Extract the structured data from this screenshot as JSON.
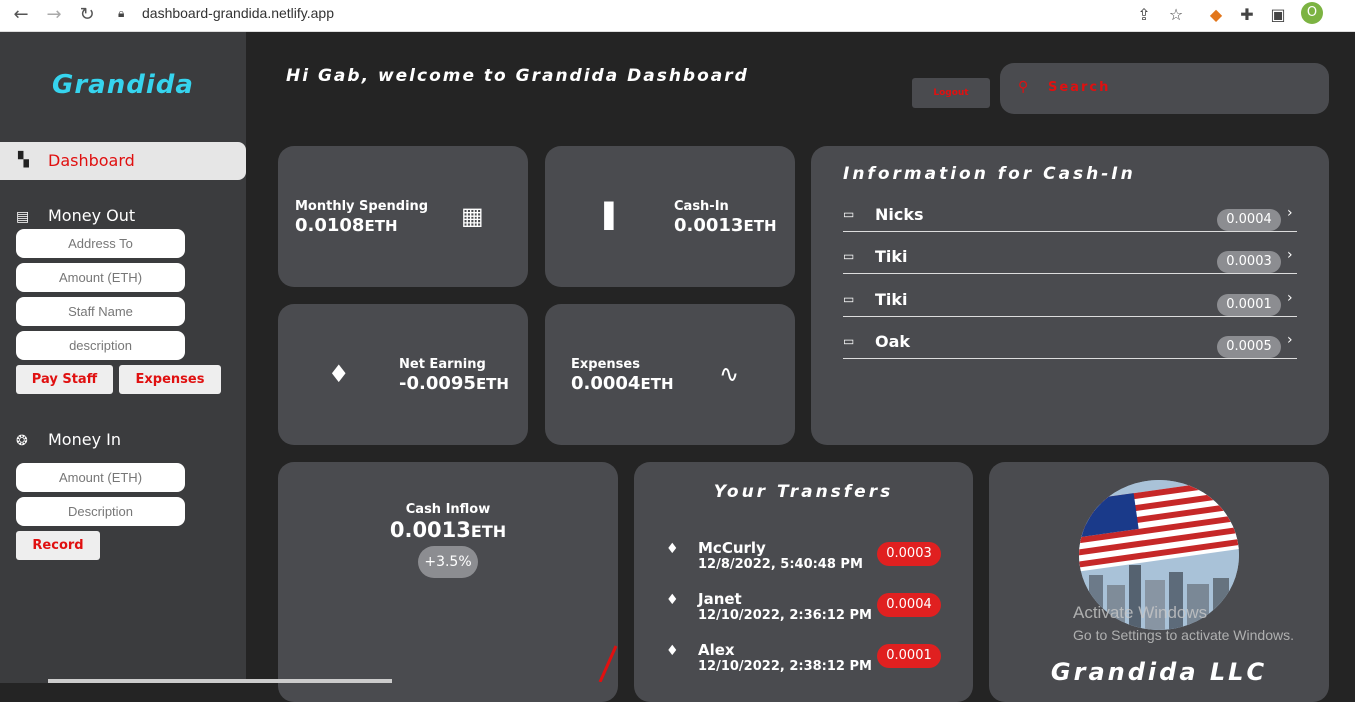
{
  "browser": {
    "url": "dashboard-grandida.netlify.app",
    "profile_initial": "O"
  },
  "sidebar": {
    "logo": "Grandida",
    "dashboard_label": "Dashboard",
    "money_out": {
      "label": "Money Out",
      "address_placeholder": "Address To",
      "amount_placeholder": "Amount (ETH)",
      "staff_placeholder": "Staff Name",
      "description_placeholder": "description",
      "pay_staff_label": "Pay Staff",
      "expenses_label": "Expenses"
    },
    "money_in": {
      "label": "Money In",
      "amount_placeholder": "Amount (ETH)",
      "description_placeholder": "Description",
      "record_label": "Record"
    }
  },
  "header": {
    "welcome": "Hi Gab, welcome to Grandida Dashboard",
    "logout_label": "Logout",
    "search_placeholder": "Search"
  },
  "stats": {
    "monthly_spending": {
      "title": "Monthly Spending",
      "value": "0.0108",
      "unit": "ETH"
    },
    "cash_in": {
      "title": "Cash-In",
      "value": "0.0013",
      "unit": "ETH"
    },
    "net_earning": {
      "title": "Net Earning",
      "value": "-0.0095",
      "unit": "ETH"
    },
    "expenses": {
      "title": "Expenses",
      "value": "0.0004",
      "unit": "ETH"
    }
  },
  "cash_in_info": {
    "title": "Information for Cash-In",
    "items": [
      {
        "name": "Nicks",
        "amount": "0.0004"
      },
      {
        "name": "Tiki",
        "amount": "0.0003"
      },
      {
        "name": "Tiki",
        "amount": "0.0001"
      },
      {
        "name": "Oak",
        "amount": "0.0005"
      }
    ]
  },
  "cash_inflow": {
    "title": "Cash Inflow",
    "value": "0.0013",
    "unit": "ETH",
    "change": "+3.5%"
  },
  "transfers": {
    "title": "Your Transfers",
    "items": [
      {
        "name": "McCurly",
        "date": "12/8/2022, 5:40:48 PM",
        "amount": "0.0003"
      },
      {
        "name": "Janet",
        "date": "12/10/2022, 2:36:12 PM",
        "amount": "0.0004"
      },
      {
        "name": "Alex",
        "date": "12/10/2022, 2:38:12 PM",
        "amount": "0.0001"
      }
    ]
  },
  "company": {
    "name": "Grandida LLC"
  },
  "watermark": {
    "line1": "Activate Windows",
    "line2": "Go to Settings to activate Windows."
  },
  "colors": {
    "accent_red": "#e01010",
    "logo_cyan": "#36d4ee",
    "card_bg": "#4a4b4f",
    "sidebar_bg": "#3b3c3e",
    "page_bg": "#242424"
  }
}
